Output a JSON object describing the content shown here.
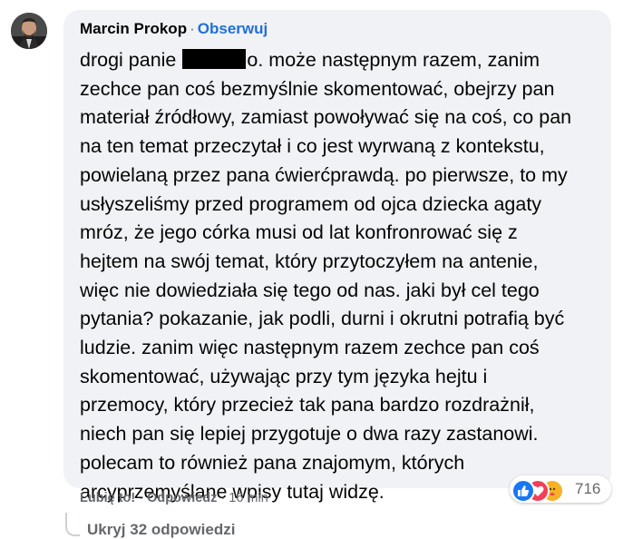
{
  "comment": {
    "author": "Marcin Prokop",
    "separator": "·",
    "follow_label": "Obserwuj",
    "lines": [
      "zechce pan coś bezmyślnie skomentować, obejrzy pan",
      "materiał źródłowy, zamiast powoływać się na coś, co pan",
      "na ten temat przeczytał i co jest wyrwaną z kontekstu,",
      "powielaną przez pana ćwierćprawdą. po pierwsze, to my",
      "usłyszeliśmy przed programem od ojca dziecka agaty",
      "mróz, że jego córka musi od lat konfronrować się z",
      "hejtem na swój temat, który przytoczyłem na antenie,",
      "więc nie dowiedziała się tego od nas. jaki był cel tego",
      "pytania? pokazanie, jak podli, durni i okrutni potrafią być",
      "ludzie. zanim więc następnym razem zechce pan coś",
      "skomentować, używając przy tym języka hejtu i",
      "przemocy, który przecież tak pana bardzo rozdrażnił,",
      "niech pan się lepiej przygotuje o dwa razy zastanowi.",
      "polecam to również pana znajomym, których",
      "arcyprzemyślane wpisy tutaj widzę."
    ],
    "first_line_start": "drogi panie",
    "first_line_tail": "o. może następnym razem, zanim"
  },
  "actions": {
    "like_label": "Lubię to!",
    "reply_label": "Odpowiedz",
    "time": "16 min",
    "separator": "·"
  },
  "reactions": {
    "count": "716",
    "types": [
      "like-icon",
      "love-icon",
      "care-icon"
    ],
    "colors": {
      "like": "#1877f2",
      "love": "#f33e58",
      "care": "#f7b125"
    }
  },
  "replies": {
    "label": "Ukryj 32 odpowiedzi"
  },
  "colors": {
    "bubble": "#f0f2f5",
    "follow": "#216fdb",
    "muted": "#65676b"
  }
}
